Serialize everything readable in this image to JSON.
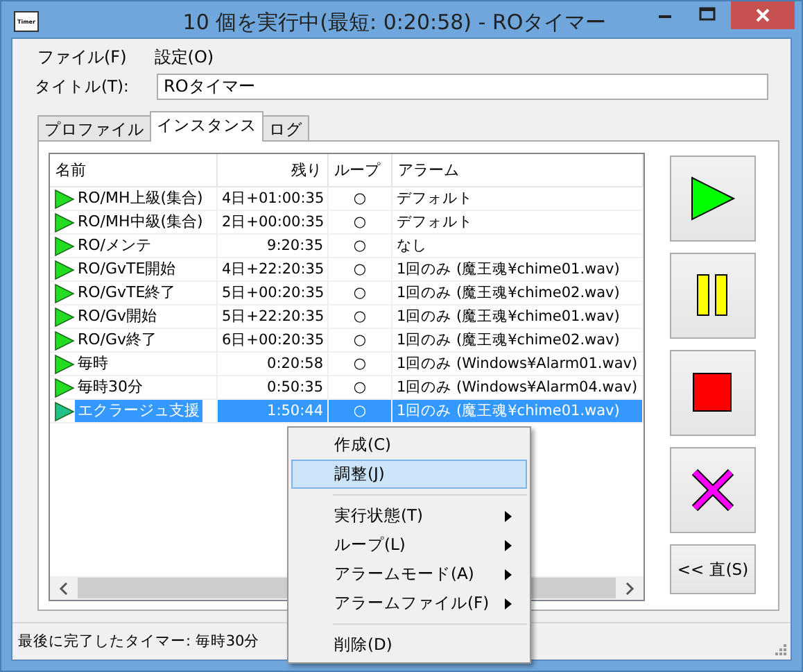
{
  "window": {
    "title": "10 個を実行中(最短: 0:20:58) - ROタイマー",
    "icon_text": "Timer"
  },
  "menu": [
    "ファイル(F)",
    "設定(O)"
  ],
  "title_field": {
    "label": "タイトル(T):",
    "value": "ROタイマー"
  },
  "tabs": [
    {
      "label": "プロファイル",
      "selected": false
    },
    {
      "label": "インスタンス",
      "selected": true
    },
    {
      "label": "ログ",
      "selected": false
    }
  ],
  "table": {
    "columns": [
      "名前",
      "残り",
      "ループ",
      "アラーム"
    ],
    "rows": [
      {
        "name": "RO/MH上級(集合)",
        "remaining": "4日+01:00:35",
        "loop": "○",
        "alarm": "デフォルト",
        "selected": false
      },
      {
        "name": "RO/MH中級(集合)",
        "remaining": "2日+00:00:35",
        "loop": "○",
        "alarm": "デフォルト",
        "selected": false
      },
      {
        "name": "RO/メンテ",
        "remaining": "9:20:35",
        "loop": "○",
        "alarm": "なし",
        "selected": false
      },
      {
        "name": "RO/GvTE開始",
        "remaining": "4日+22:20:35",
        "loop": "○",
        "alarm": "1回のみ (魔王魂¥chime01.wav)",
        "selected": false
      },
      {
        "name": "RO/GvTE終了",
        "remaining": "5日+00:20:35",
        "loop": "○",
        "alarm": "1回のみ (魔王魂¥chime02.wav)",
        "selected": false
      },
      {
        "name": "RO/Gv開始",
        "remaining": "5日+22:20:35",
        "loop": "○",
        "alarm": "1回のみ (魔王魂¥chime01.wav)",
        "selected": false
      },
      {
        "name": "RO/Gv終了",
        "remaining": "6日+00:20:35",
        "loop": "○",
        "alarm": "1回のみ (魔王魂¥chime02.wav)",
        "selected": false
      },
      {
        "name": "毎時",
        "remaining": "0:20:58",
        "loop": "○",
        "alarm": "1回のみ (Windows¥Alarm01.wav)",
        "selected": false
      },
      {
        "name": "毎時30分",
        "remaining": "0:50:35",
        "loop": "○",
        "alarm": "1回のみ (Windows¥Alarm04.wav)",
        "selected": false
      },
      {
        "name": "エクラージュ支援",
        "remaining": "1:50:44",
        "loop": "○",
        "alarm": "1回のみ (魔王魂¥chime01.wav)",
        "selected": true
      }
    ]
  },
  "side_buttons": [
    {
      "kind": "play"
    },
    {
      "kind": "pause"
    },
    {
      "kind": "stop"
    },
    {
      "kind": "delete"
    },
    {
      "kind": "text",
      "label": "<< 直(S)"
    }
  ],
  "context_menu": [
    {
      "kind": "item",
      "label": "作成(C)",
      "selected": false,
      "submenu": false
    },
    {
      "kind": "item",
      "label": "調整(J)",
      "selected": true,
      "submenu": false
    },
    {
      "kind": "separator"
    },
    {
      "kind": "item",
      "label": "実行状態(T)",
      "selected": false,
      "submenu": true
    },
    {
      "kind": "item",
      "label": "ループ(L)",
      "selected": false,
      "submenu": true
    },
    {
      "kind": "item",
      "label": "アラームモード(A)",
      "selected": false,
      "submenu": true
    },
    {
      "kind": "item",
      "label": "アラームファイル(F)",
      "selected": false,
      "submenu": true
    },
    {
      "kind": "separator"
    },
    {
      "kind": "item",
      "label": "削除(D)",
      "selected": false,
      "submenu": false
    }
  ],
  "status_bar": "最後に完了したタイマー: 毎時30分"
}
